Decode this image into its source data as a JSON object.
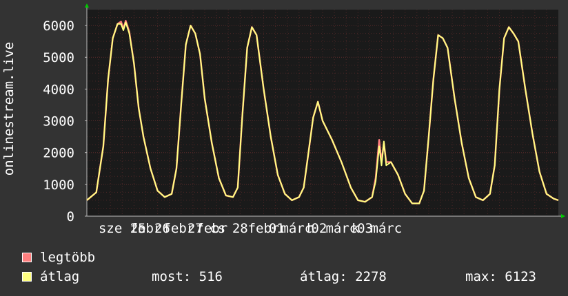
{
  "chart_data": {
    "type": "line",
    "ylabel": "onlinestream.live",
    "ylim": [
      0,
      6500
    ],
    "yticks": [
      0,
      1000,
      2000,
      3000,
      4000,
      5000,
      6000
    ],
    "grid": true,
    "x_tick_labels": [
      {
        "label": "sze 25",
        "t": 1.5
      },
      {
        "label": "febr",
        "t": 2.5
      },
      {
        "label": "26",
        "t": 3.2
      },
      {
        "label": "febr",
        "t": 3.9
      },
      {
        "label": "27",
        "t": 4.6
      },
      {
        "label": "febr",
        "t": 5.3
      },
      {
        "label": "cs",
        "t": 5.55
      },
      {
        "label": "28",
        "t": 6.5
      },
      {
        "label": "febr",
        "t": 7.5
      },
      {
        "label": "01",
        "t": 8.05
      },
      {
        "label": "márc",
        "t": 8.9
      },
      {
        "label": "h",
        "t": 9.5
      },
      {
        "label": "02",
        "t": 9.85
      },
      {
        "label": "márc",
        "t": 10.8
      },
      {
        "label": "k",
        "t": 11.4
      },
      {
        "label": "03",
        "t": 11.8
      },
      {
        "label": "márc",
        "t": 12.7
      }
    ],
    "series": [
      {
        "name": "legtöbb",
        "color": "#ff7f7f",
        "points": [
          [
            0.0,
            500
          ],
          [
            0.4,
            750
          ],
          [
            0.7,
            2200
          ],
          [
            0.9,
            4300
          ],
          [
            1.1,
            5600
          ],
          [
            1.3,
            6050
          ],
          [
            1.45,
            6123
          ],
          [
            1.55,
            5900
          ],
          [
            1.65,
            6150
          ],
          [
            1.8,
            5800
          ],
          [
            2.0,
            4800
          ],
          [
            2.2,
            3400
          ],
          [
            2.4,
            2500
          ],
          [
            2.7,
            1500
          ],
          [
            3.0,
            800
          ],
          [
            3.3,
            600
          ],
          [
            3.6,
            700
          ],
          [
            3.8,
            1500
          ],
          [
            4.0,
            3500
          ],
          [
            4.2,
            5400
          ],
          [
            4.4,
            6000
          ],
          [
            4.6,
            5750
          ],
          [
            4.8,
            5100
          ],
          [
            5.0,
            3700
          ],
          [
            5.3,
            2300
          ],
          [
            5.6,
            1200
          ],
          [
            5.9,
            650
          ],
          [
            6.2,
            600
          ],
          [
            6.4,
            900
          ],
          [
            6.6,
            3200
          ],
          [
            6.8,
            5300
          ],
          [
            7.0,
            5950
          ],
          [
            7.2,
            5700
          ],
          [
            7.5,
            4000
          ],
          [
            7.8,
            2500
          ],
          [
            8.1,
            1300
          ],
          [
            8.4,
            700
          ],
          [
            8.7,
            500
          ],
          [
            9.0,
            600
          ],
          [
            9.2,
            900
          ],
          [
            9.4,
            2000
          ],
          [
            9.6,
            3100
          ],
          [
            9.8,
            3600
          ],
          [
            10.0,
            3000
          ],
          [
            10.4,
            2400
          ],
          [
            10.8,
            1700
          ],
          [
            11.2,
            900
          ],
          [
            11.5,
            500
          ],
          [
            11.8,
            450
          ],
          [
            12.1,
            600
          ],
          [
            12.25,
            1200
          ],
          [
            12.4,
            2400
          ],
          [
            12.5,
            1700
          ],
          [
            12.6,
            2300
          ],
          [
            12.7,
            1700
          ],
          [
            12.9,
            1700
          ],
          [
            13.2,
            1300
          ],
          [
            13.5,
            700
          ],
          [
            13.8,
            400
          ],
          [
            14.1,
            400
          ],
          [
            14.3,
            800
          ],
          [
            14.5,
            2500
          ],
          [
            14.7,
            4300
          ],
          [
            14.9,
            5700
          ],
          [
            15.1,
            5600
          ],
          [
            15.3,
            5300
          ],
          [
            15.6,
            3700
          ],
          [
            15.9,
            2300
          ],
          [
            16.2,
            1200
          ],
          [
            16.5,
            600
          ],
          [
            16.8,
            500
          ],
          [
            17.1,
            700
          ],
          [
            17.3,
            1600
          ],
          [
            17.5,
            4000
          ],
          [
            17.7,
            5600
          ],
          [
            17.9,
            5950
          ],
          [
            18.1,
            5750
          ],
          [
            18.3,
            5500
          ],
          [
            18.6,
            4000
          ],
          [
            18.9,
            2600
          ],
          [
            19.2,
            1400
          ],
          [
            19.5,
            700
          ],
          [
            19.8,
            550
          ],
          [
            20.0,
            500
          ]
        ]
      },
      {
        "name": "átlag",
        "color": "#ffff80",
        "points": [
          [
            0.0,
            500
          ],
          [
            0.4,
            750
          ],
          [
            0.7,
            2200
          ],
          [
            0.9,
            4300
          ],
          [
            1.1,
            5600
          ],
          [
            1.3,
            6050
          ],
          [
            1.45,
            6050
          ],
          [
            1.55,
            5850
          ],
          [
            1.65,
            6100
          ],
          [
            1.8,
            5750
          ],
          [
            2.0,
            4800
          ],
          [
            2.2,
            3400
          ],
          [
            2.4,
            2500
          ],
          [
            2.7,
            1500
          ],
          [
            3.0,
            800
          ],
          [
            3.3,
            600
          ],
          [
            3.6,
            700
          ],
          [
            3.8,
            1500
          ],
          [
            4.0,
            3500
          ],
          [
            4.2,
            5400
          ],
          [
            4.4,
            6000
          ],
          [
            4.6,
            5750
          ],
          [
            4.8,
            5100
          ],
          [
            5.0,
            3700
          ],
          [
            5.3,
            2300
          ],
          [
            5.6,
            1200
          ],
          [
            5.9,
            650
          ],
          [
            6.2,
            600
          ],
          [
            6.4,
            900
          ],
          [
            6.6,
            3200
          ],
          [
            6.8,
            5300
          ],
          [
            7.0,
            5950
          ],
          [
            7.2,
            5700
          ],
          [
            7.5,
            4000
          ],
          [
            7.8,
            2500
          ],
          [
            8.1,
            1300
          ],
          [
            8.4,
            700
          ],
          [
            8.7,
            500
          ],
          [
            9.0,
            600
          ],
          [
            9.2,
            900
          ],
          [
            9.4,
            2000
          ],
          [
            9.6,
            3100
          ],
          [
            9.8,
            3600
          ],
          [
            10.0,
            3000
          ],
          [
            10.4,
            2400
          ],
          [
            10.8,
            1700
          ],
          [
            11.2,
            900
          ],
          [
            11.5,
            500
          ],
          [
            11.8,
            450
          ],
          [
            12.1,
            600
          ],
          [
            12.25,
            1100
          ],
          [
            12.4,
            2200
          ],
          [
            12.5,
            1600
          ],
          [
            12.6,
            2350
          ],
          [
            12.7,
            1600
          ],
          [
            12.9,
            1700
          ],
          [
            13.2,
            1300
          ],
          [
            13.5,
            700
          ],
          [
            13.8,
            400
          ],
          [
            14.1,
            400
          ],
          [
            14.3,
            800
          ],
          [
            14.5,
            2500
          ],
          [
            14.7,
            4300
          ],
          [
            14.9,
            5700
          ],
          [
            15.1,
            5600
          ],
          [
            15.3,
            5300
          ],
          [
            15.6,
            3700
          ],
          [
            15.9,
            2300
          ],
          [
            16.2,
            1200
          ],
          [
            16.5,
            600
          ],
          [
            16.8,
            500
          ],
          [
            17.1,
            700
          ],
          [
            17.3,
            1600
          ],
          [
            17.5,
            4000
          ],
          [
            17.7,
            5600
          ],
          [
            17.9,
            5950
          ],
          [
            18.1,
            5750
          ],
          [
            18.3,
            5500
          ],
          [
            18.6,
            4000
          ],
          [
            18.9,
            2600
          ],
          [
            19.2,
            1400
          ],
          [
            19.5,
            700
          ],
          [
            19.8,
            550
          ],
          [
            20.0,
            500
          ]
        ]
      }
    ]
  },
  "legend": {
    "max_label": "legtöbb",
    "avg_label": "átlag"
  },
  "stats": {
    "now": "most: 516",
    "avg": "átlag: 2278",
    "max": "max: 6123"
  },
  "colors": {
    "background": "#333333",
    "plot_bg": "#1a1a1a",
    "grid": "#5a2a2a",
    "max_line": "#ff7f7f",
    "avg_line": "#ffff80",
    "arrow": "#00cc00"
  }
}
